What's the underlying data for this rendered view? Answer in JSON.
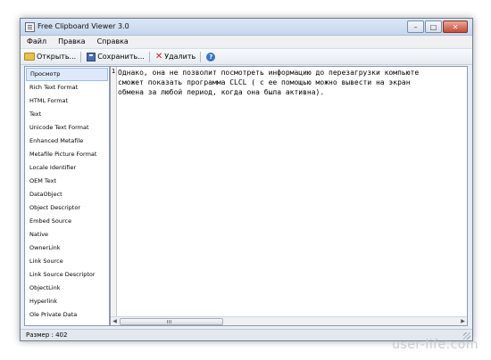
{
  "window": {
    "title": "Free Clipboard Viewer 3.0"
  },
  "menu": [
    "Файл",
    "Правка",
    "Справка"
  ],
  "toolbar": {
    "open_label": "Открыть...",
    "save_label": "Сохранить...",
    "delete_label": "Удалить"
  },
  "formats": [
    "Просмотр",
    "Rich Text Format",
    "HTML Format",
    "Text",
    "Unicode Text Format",
    "Enhanced Metafile",
    "Metafile Picture Format",
    "Locale Identifier",
    "OEM Text",
    "DataObject",
    "Object Descriptor",
    "Embed Source",
    "Native",
    "OwnerLink",
    "Link Source",
    "Link Source Descriptor",
    "ObjectLink",
    "Hyperlink",
    "Ole Private Data"
  ],
  "selected_format": "Просмотр",
  "editor": {
    "line_number": "1",
    "lines": [
      "Однако, она не позволит посмотреть информацию до перезагрузки компьюте",
      "сможет показать программа CLCL ( с ее помощью можно вывести на экран",
      "обмена за любой период, когда она была активна)."
    ]
  },
  "status": {
    "size_text": "Размер : 402"
  },
  "watermark": "user-life.com"
}
